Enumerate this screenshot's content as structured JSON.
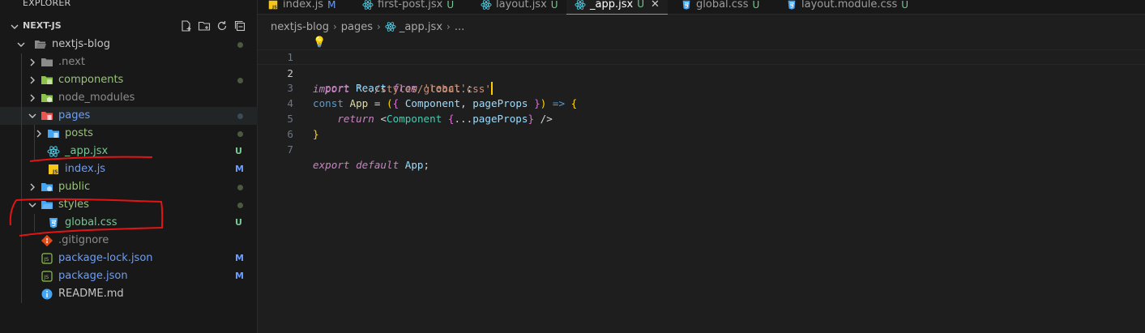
{
  "sidebar": {
    "title": "EXPLORER",
    "section": "NEXT-JS",
    "rows": [
      {
        "name": "nextjs-blog",
        "indent": 0,
        "twisty": "open",
        "icon": "folder-open-icon",
        "color": "#c5c5c5",
        "status": "dot"
      },
      {
        "name": ".next",
        "indent": 1,
        "twisty": "closed",
        "icon": "folder-icon",
        "color": "#8b8b8b",
        "status": ""
      },
      {
        "name": "components",
        "indent": 1,
        "twisty": "closed",
        "icon": "folder-components-icon",
        "color": "#98c379",
        "status": "dot"
      },
      {
        "name": "node_modules",
        "indent": 1,
        "twisty": "closed",
        "icon": "folder-node-icon",
        "color": "#8b8b8b",
        "status": ""
      },
      {
        "name": "pages",
        "indent": 1,
        "twisty": "open",
        "icon": "folder-pages-icon",
        "color": "#6c9ef8",
        "status": "dotgrey",
        "selected": true
      },
      {
        "name": "posts",
        "indent": 2,
        "twisty": "closed",
        "icon": "folder-posts-icon",
        "color": "#98c379",
        "status": "dot"
      },
      {
        "name": "_app.jsx",
        "indent": 2,
        "twisty": "",
        "icon": "react-icon",
        "color": "#73c991",
        "status": "U"
      },
      {
        "name": "index.js",
        "indent": 2,
        "twisty": "",
        "icon": "js-icon",
        "color": "#6c9ef8",
        "status": "M"
      },
      {
        "name": "public",
        "indent": 1,
        "twisty": "closed",
        "icon": "folder-public-icon",
        "color": "#98c379",
        "status": "dot"
      },
      {
        "name": "styles",
        "indent": 1,
        "twisty": "open",
        "icon": "folder-styles-icon",
        "color": "#98c379",
        "status": "dot"
      },
      {
        "name": "global.css",
        "indent": 2,
        "twisty": "",
        "icon": "css-icon",
        "color": "#73c991",
        "status": "U"
      },
      {
        "name": ".gitignore",
        "indent": 1,
        "twisty": "",
        "icon": "git-icon",
        "color": "#8b8b8b",
        "status": ""
      },
      {
        "name": "package-lock.json",
        "indent": 1,
        "twisty": "",
        "icon": "npm-icon",
        "color": "#6c9ef8",
        "status": "M"
      },
      {
        "name": "package.json",
        "indent": 1,
        "twisty": "",
        "icon": "npm-icon",
        "color": "#6c9ef8",
        "status": "M"
      },
      {
        "name": "README.md",
        "indent": 1,
        "twisty": "",
        "icon": "info-icon",
        "color": "#c5c5c5",
        "status": ""
      }
    ]
  },
  "tabs": [
    {
      "label": "index.js",
      "status": "M",
      "icon": "js-icon",
      "statusColor": "#6c9ef8"
    },
    {
      "label": "first-post.jsx",
      "status": "U",
      "icon": "react-icon",
      "statusColor": "#73c991"
    },
    {
      "label": "layout.jsx",
      "status": "U",
      "icon": "react-icon",
      "statusColor": "#73c991"
    },
    {
      "label": "_app.jsx",
      "status": "U",
      "icon": "react-icon",
      "statusColor": "#73c991",
      "active": true
    },
    {
      "label": "global.css",
      "status": "U",
      "icon": "css-icon",
      "statusColor": "#73c991"
    },
    {
      "label": "layout.module.css",
      "status": "U",
      "icon": "css-icon",
      "statusColor": "#73c991"
    }
  ],
  "breadcrumb": {
    "parts": [
      "nextjs-blog",
      "pages",
      "_app.jsx",
      "..."
    ]
  },
  "editor": {
    "current_line": 2,
    "lines": [
      {
        "n": "1",
        "text": "import React from 'react';"
      },
      {
        "n": "2",
        "text": "import '../styles/global.css'"
      },
      {
        "n": "3",
        "text": "const App = ({ Component, pageProps }) => {"
      },
      {
        "n": "4",
        "text": "    return <Component {...pageProps} />"
      },
      {
        "n": "5",
        "text": "}"
      },
      {
        "n": "6",
        "text": ""
      },
      {
        "n": "7",
        "text": "export default App;"
      }
    ]
  },
  "colors": {
    "accent": "#4db6ac",
    "untracked": "#73c991",
    "modified": "#6c9ef8",
    "annotation": "#e51414"
  }
}
